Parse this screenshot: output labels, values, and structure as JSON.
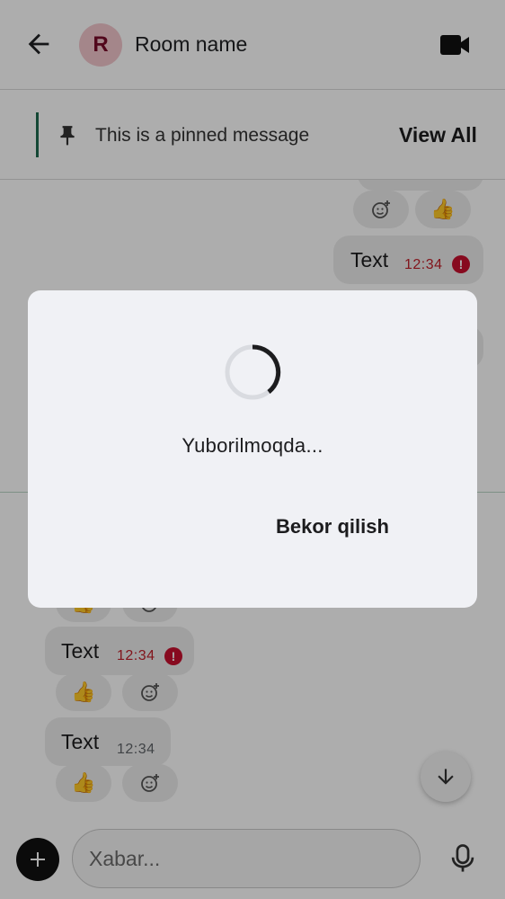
{
  "header": {
    "avatar_initial": "R",
    "room_name": "Room name",
    "back_icon": "arrow-left-icon",
    "video_icon": "video-camera-icon"
  },
  "pinned": {
    "text": "This is a pinned message",
    "view_all_label": "View All",
    "icon": "pin-icon"
  },
  "messages": [
    {
      "side": "outgoing",
      "text": "Text",
      "time": "12:34",
      "status": "error"
    },
    {
      "side": "incoming",
      "text": "Text",
      "time": "12:34",
      "status": "error"
    },
    {
      "side": "incoming",
      "text": "Text",
      "time": "12:34",
      "status": "sent"
    }
  ],
  "reactions": {
    "thumbs_up": "👍",
    "add_reaction_icon": "emoji-add-icon"
  },
  "input": {
    "placeholder": "Xabar..."
  },
  "dialog": {
    "message": "Yuborilmoqda...",
    "cancel_label": "Bekor qilish"
  },
  "colors": {
    "accent": "#1e6b4e",
    "error": "#c8102e",
    "avatar_bg": "#f2c6cc"
  }
}
